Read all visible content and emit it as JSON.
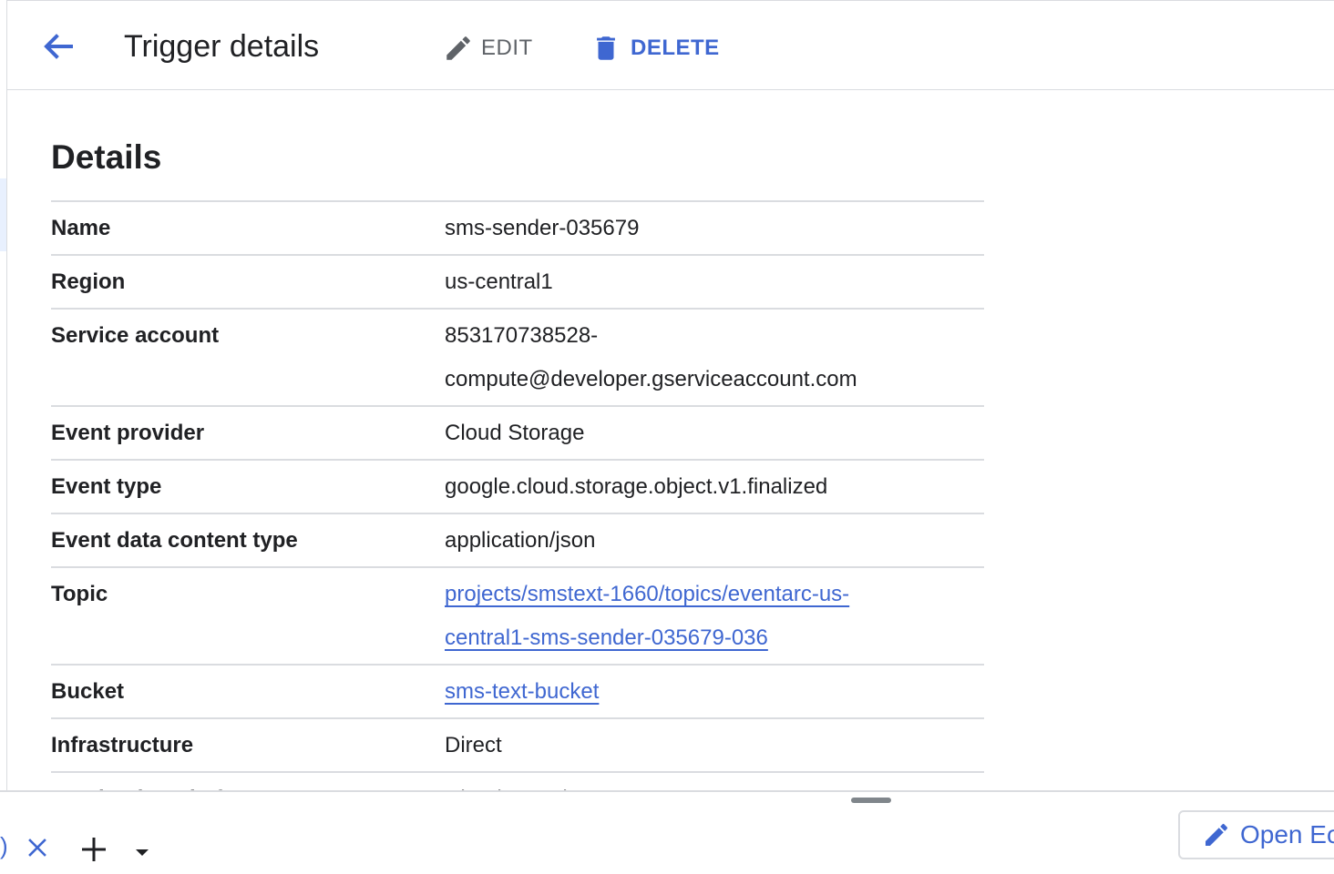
{
  "header": {
    "title": "Trigger details",
    "edit_label": "EDIT",
    "delete_label": "DELETE",
    "back_icon": "arrow-back-icon",
    "edit_icon": "pencil-icon",
    "delete_icon": "trash-icon"
  },
  "section": {
    "title": "Details"
  },
  "details": {
    "name": {
      "label": "Name",
      "value": "sms-sender-035679"
    },
    "region": {
      "label": "Region",
      "value": "us-central1"
    },
    "service_account": {
      "label": "Service account",
      "value_line1": "853170738528-",
      "value_line2": "compute@developer.gserviceaccount.com"
    },
    "event_provider": {
      "label": "Event provider",
      "value": "Cloud Storage"
    },
    "event_type": {
      "label": "Event type",
      "value": "google.cloud.storage.object.v1.finalized"
    },
    "event_data_content_type": {
      "label": "Event data content type",
      "value": "application/json"
    },
    "topic": {
      "label": "Topic",
      "value_line1": "projects/smstext-1660/topics/eventarc-us-",
      "value_line2": "central1-sms-sender-035679-036"
    },
    "bucket": {
      "label": "Bucket",
      "value": "sms-text-bucket"
    },
    "infrastructure": {
      "label": "Infrastructure",
      "value": "Direct"
    },
    "destination_platform": {
      "label": "Destination platform",
      "value": "Cloud Functions"
    }
  },
  "bottom_bar": {
    "tab_fragment": ")",
    "open_editor_label": "Open Ec"
  },
  "colors": {
    "accent": "#3f67d1",
    "text": "#202124",
    "muted": "#5f6368",
    "divider": "#dadce0"
  }
}
